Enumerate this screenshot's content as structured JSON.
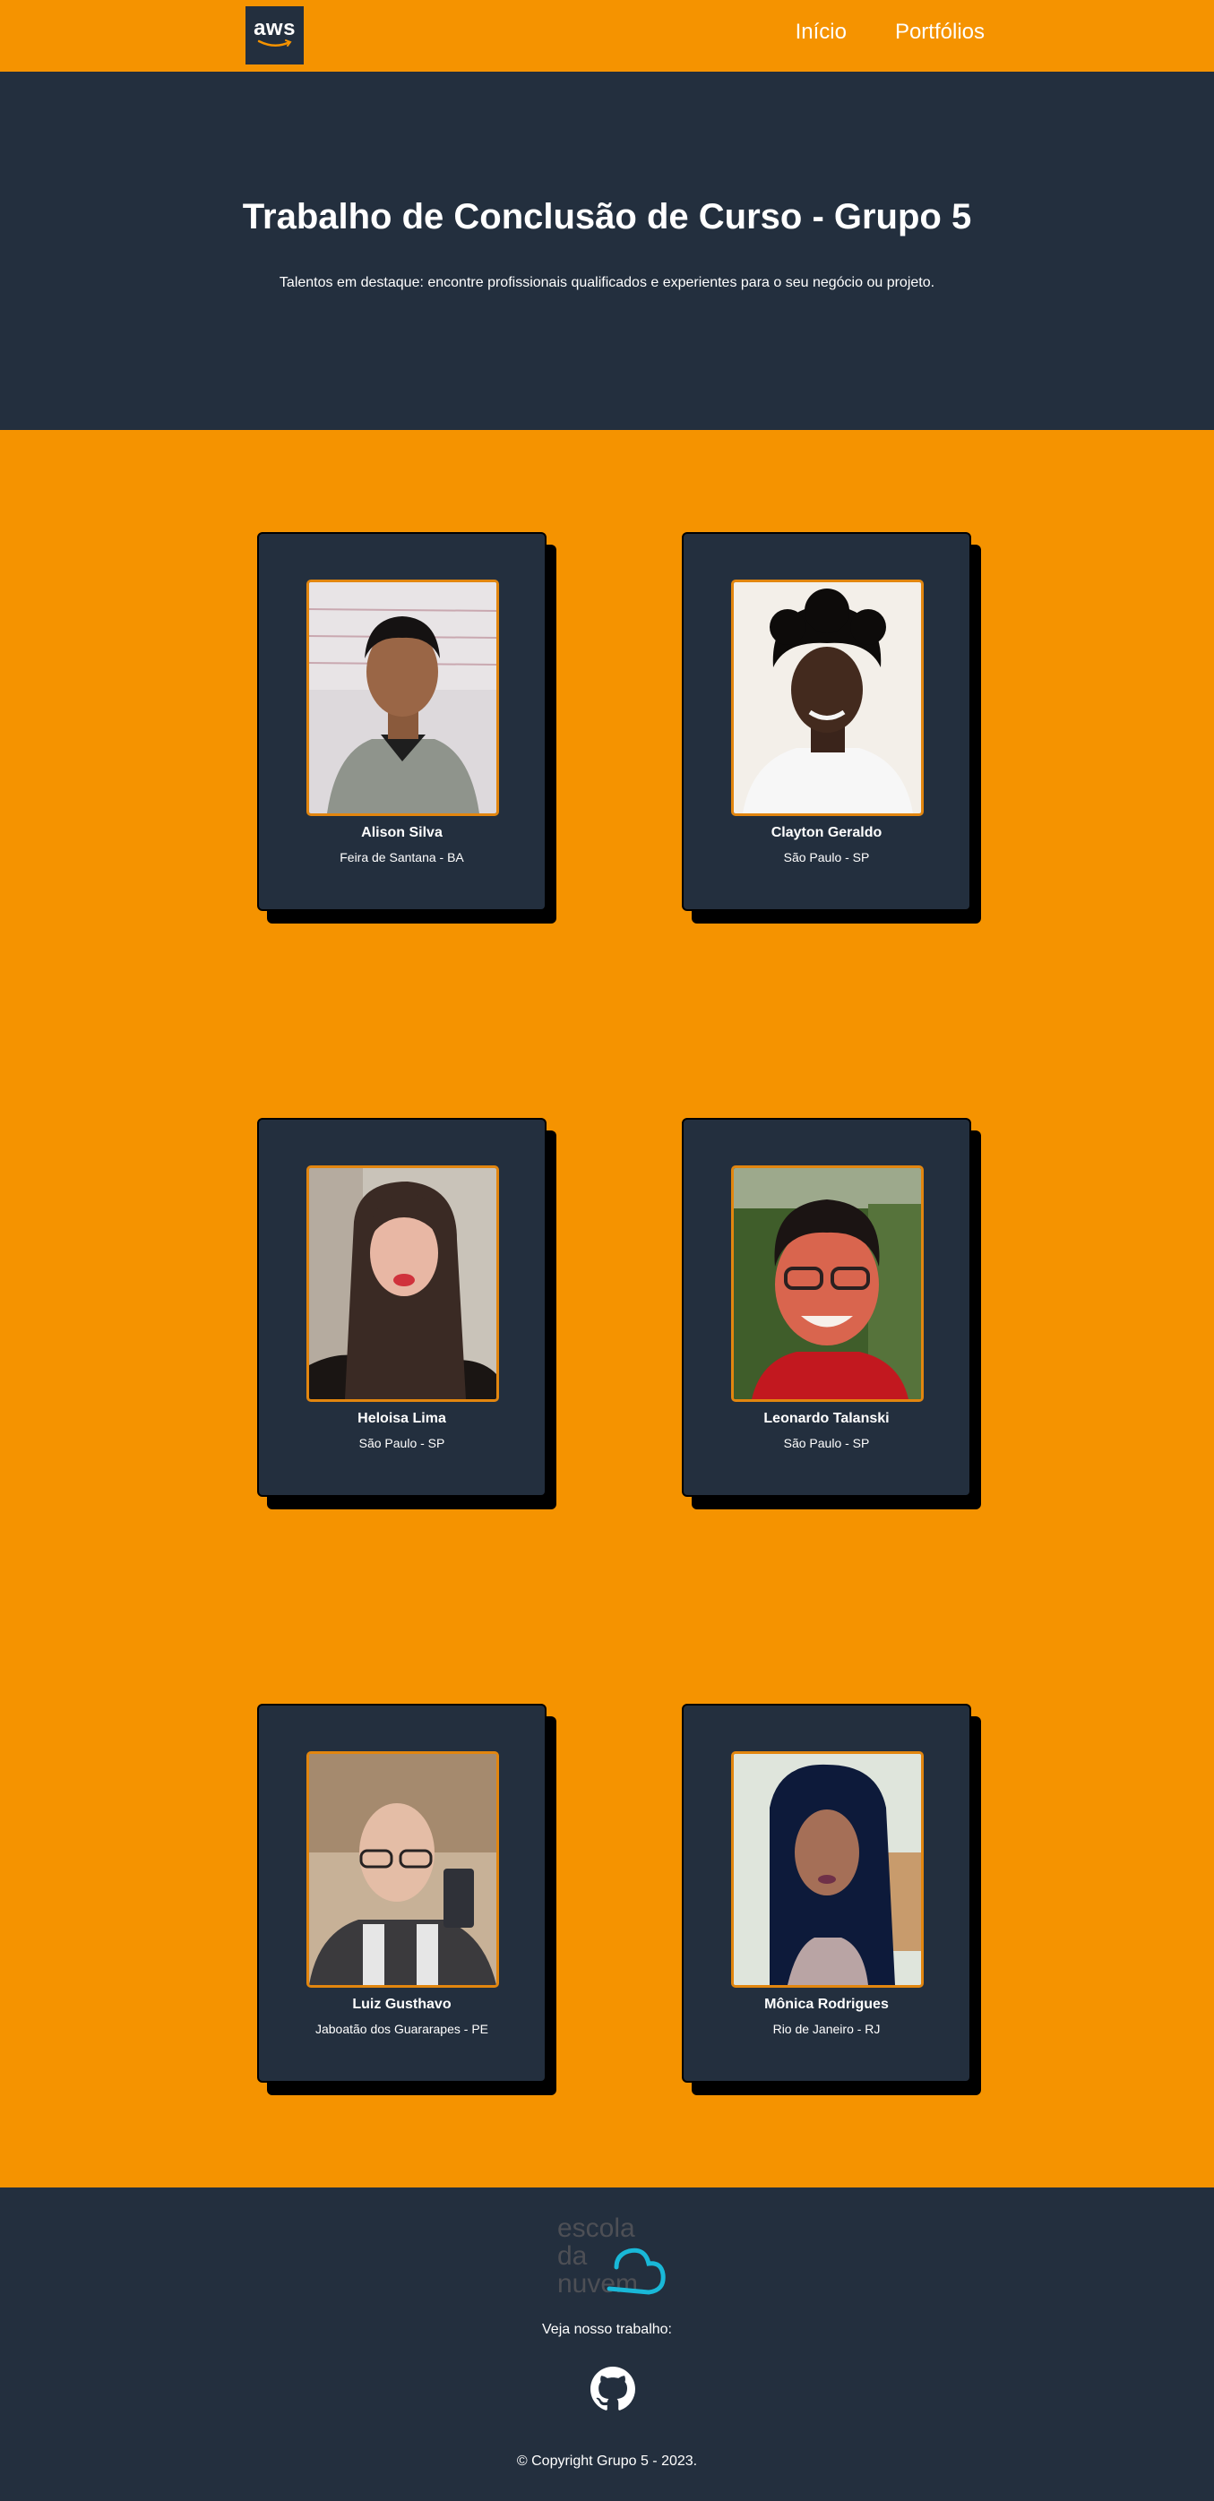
{
  "colors": {
    "accent": "#f59300",
    "dark": "#232f3e",
    "photo_border": "#e2860f",
    "nuvem_cyan": "#19b8d8"
  },
  "nav": {
    "logo_text": "aws",
    "links": [
      "Início",
      "Portfólios"
    ]
  },
  "hero": {
    "title": "Trabalho de Conclusão de Curso - Grupo 5",
    "subtitle": "Talentos em destaque: encontre profissionais qualificados e experientes para o seu negócio ou projeto."
  },
  "team": [
    {
      "name": "Alison Silva",
      "location": "Feira de Santana - BA"
    },
    {
      "name": "Clayton Geraldo",
      "location": "São Paulo - SP"
    },
    {
      "name": "Heloisa Lima",
      "location": "São Paulo - SP"
    },
    {
      "name": "Leonardo Talanski",
      "location": "São Paulo - SP"
    },
    {
      "name": "Luiz Gusthavo",
      "location": "Jaboatão dos Guararapes - PE"
    },
    {
      "name": "Mônica Rodrigues",
      "location": "Rio de Janeiro - RJ"
    }
  ],
  "footer": {
    "logo_lines": [
      "escola",
      "da",
      "nuvem."
    ],
    "cta": "Veja nosso trabalho:",
    "github_icon": "github-icon",
    "copyright": "© Copyright Grupo 5 - 2023."
  }
}
